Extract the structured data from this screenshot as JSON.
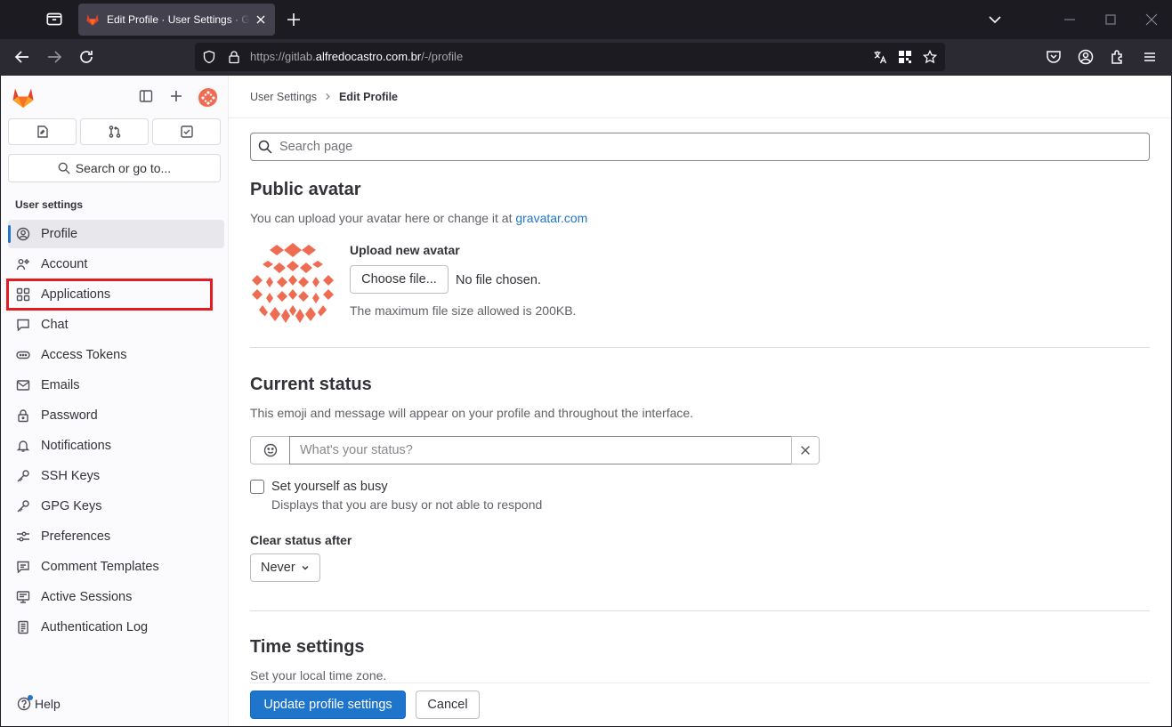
{
  "browser": {
    "tab_title": "Edit Profile · User Settings · GitLab",
    "url_prefix": "https://gitlab.",
    "url_host": "alfredocastro.com.br",
    "url_path": "/-/profile"
  },
  "sidebar": {
    "search_label": "Search or go to...",
    "section_title": "User settings",
    "items": [
      {
        "label": "Profile",
        "icon": "profile-icon",
        "active": true
      },
      {
        "label": "Account",
        "icon": "account-icon"
      },
      {
        "label": "Applications",
        "icon": "applications-icon"
      },
      {
        "label": "Chat",
        "icon": "chat-icon"
      },
      {
        "label": "Access Tokens",
        "icon": "token-icon"
      },
      {
        "label": "Emails",
        "icon": "mail-icon"
      },
      {
        "label": "Password",
        "icon": "lock-icon"
      },
      {
        "label": "Notifications",
        "icon": "bell-icon"
      },
      {
        "label": "SSH Keys",
        "icon": "key-icon"
      },
      {
        "label": "GPG Keys",
        "icon": "key-icon"
      },
      {
        "label": "Preferences",
        "icon": "preferences-icon"
      },
      {
        "label": "Comment Templates",
        "icon": "comment-icon"
      },
      {
        "label": "Active Sessions",
        "icon": "monitor-icon"
      },
      {
        "label": "Authentication Log",
        "icon": "log-icon"
      }
    ],
    "help_label": "Help"
  },
  "breadcrumb": {
    "parent": "User Settings",
    "current": "Edit Profile"
  },
  "main": {
    "search_placeholder": "Search page",
    "avatar": {
      "title": "Public avatar",
      "desc_prefix": "You can upload your avatar here or change it at ",
      "desc_link": "gravatar.com",
      "upload_label": "Upload new avatar",
      "choose_button": "Choose file...",
      "no_file": "No file chosen.",
      "max_size": "The maximum file size allowed is 200KB."
    },
    "status": {
      "title": "Current status",
      "desc": "This emoji and message will appear on your profile and throughout the interface.",
      "placeholder": "What's your status?",
      "busy_label": "Set yourself as busy",
      "busy_help": "Displays that you are busy or not able to respond",
      "clear_after_label": "Clear status after",
      "clear_after_value": "Never"
    },
    "time": {
      "title": "Time settings",
      "desc": "Set your local time zone."
    },
    "update_button": "Update profile settings",
    "cancel_button": "Cancel"
  },
  "colors": {
    "accent": "#1f75cb",
    "highlight": "#e11d21",
    "gitlab_orange": "#fc6d26",
    "avatar_salmon": "#ee6c52"
  }
}
